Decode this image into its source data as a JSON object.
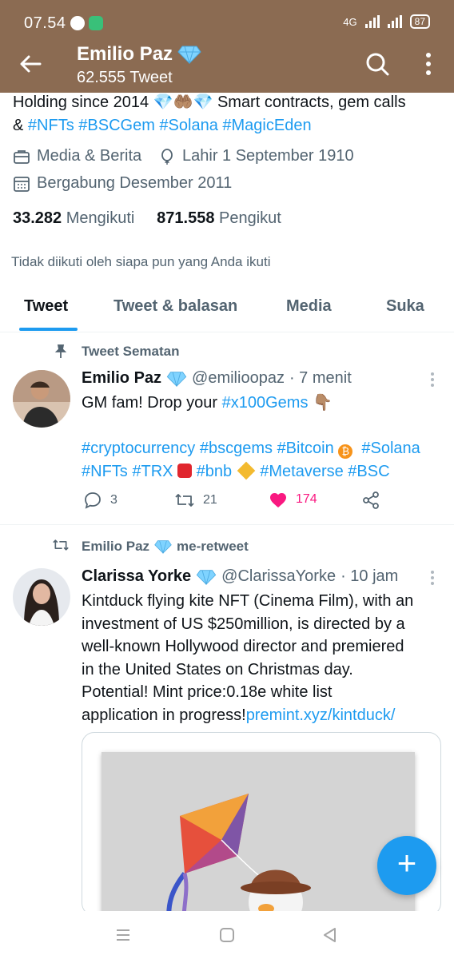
{
  "status_bar": {
    "time": "07.54",
    "network": "4G",
    "battery": "87"
  },
  "header": {
    "name": "Emilio Paz",
    "tweet_count": "62.555 Tweet"
  },
  "profile": {
    "bio_line1": "Holding since 2014 💎🤲🏽💎 Smart contracts, gem calls",
    "bio_amp": "& ",
    "bio_tags": [
      "#NFTs",
      "#BSCGem",
      "#Solana",
      "#MagicEden"
    ],
    "category": "Media & Berita",
    "birth": "Lahir 1 September 1910",
    "joined": "Bergabung Desember 2011",
    "following_count": "33.282",
    "following_label": "Mengikuti",
    "followers_count": "871.558",
    "followers_label": "Pengikut",
    "not_followed": "Tidak diikuti oleh siapa pun yang Anda ikuti"
  },
  "tabs": [
    "Tweet",
    "Tweet & balasan",
    "Media",
    "Suka"
  ],
  "tweets": [
    {
      "context": "Tweet Sematan",
      "author": "Emilio Paz",
      "handle": "@emilioopaz",
      "time": "· 7 menit",
      "text_line1": "GM fam! Drop your",
      "text_tag1": "#x100Gems",
      "text_emoji1": "👇🏽",
      "tags_line1": [
        "#cryptocurrency",
        "#bscgems",
        "#Bitcoin"
      ],
      "tags_line1b": "#Solana",
      "tags_line2": [
        "#NFTs",
        "#TRX",
        "#bnb",
        "#Metaverse",
        "#BSC"
      ],
      "replies": "3",
      "retweets": "21",
      "likes": "174"
    },
    {
      "context": "Emilio Paz",
      "context_suffix": "me-retweet",
      "author": "Clarissa Yorke",
      "handle": "@ClarissaYorke",
      "time": "· 10 jam",
      "lines": [
        "Kintduck flying kite NFT (Cinema Film), with an",
        "investment of US $250million, is directed by a",
        "well-known Hollywood director and premiered",
        "in the United States on Christmas day.",
        "Potential! Mint price:0.18e white list"
      ],
      "last_line": "application in progress!",
      "link": "premint.xyz/kintduck/"
    }
  ],
  "fab_label": "+",
  "colors": {
    "header_bg": "#8b6b52",
    "accent": "#1d9bf0",
    "like": "#f91880"
  }
}
